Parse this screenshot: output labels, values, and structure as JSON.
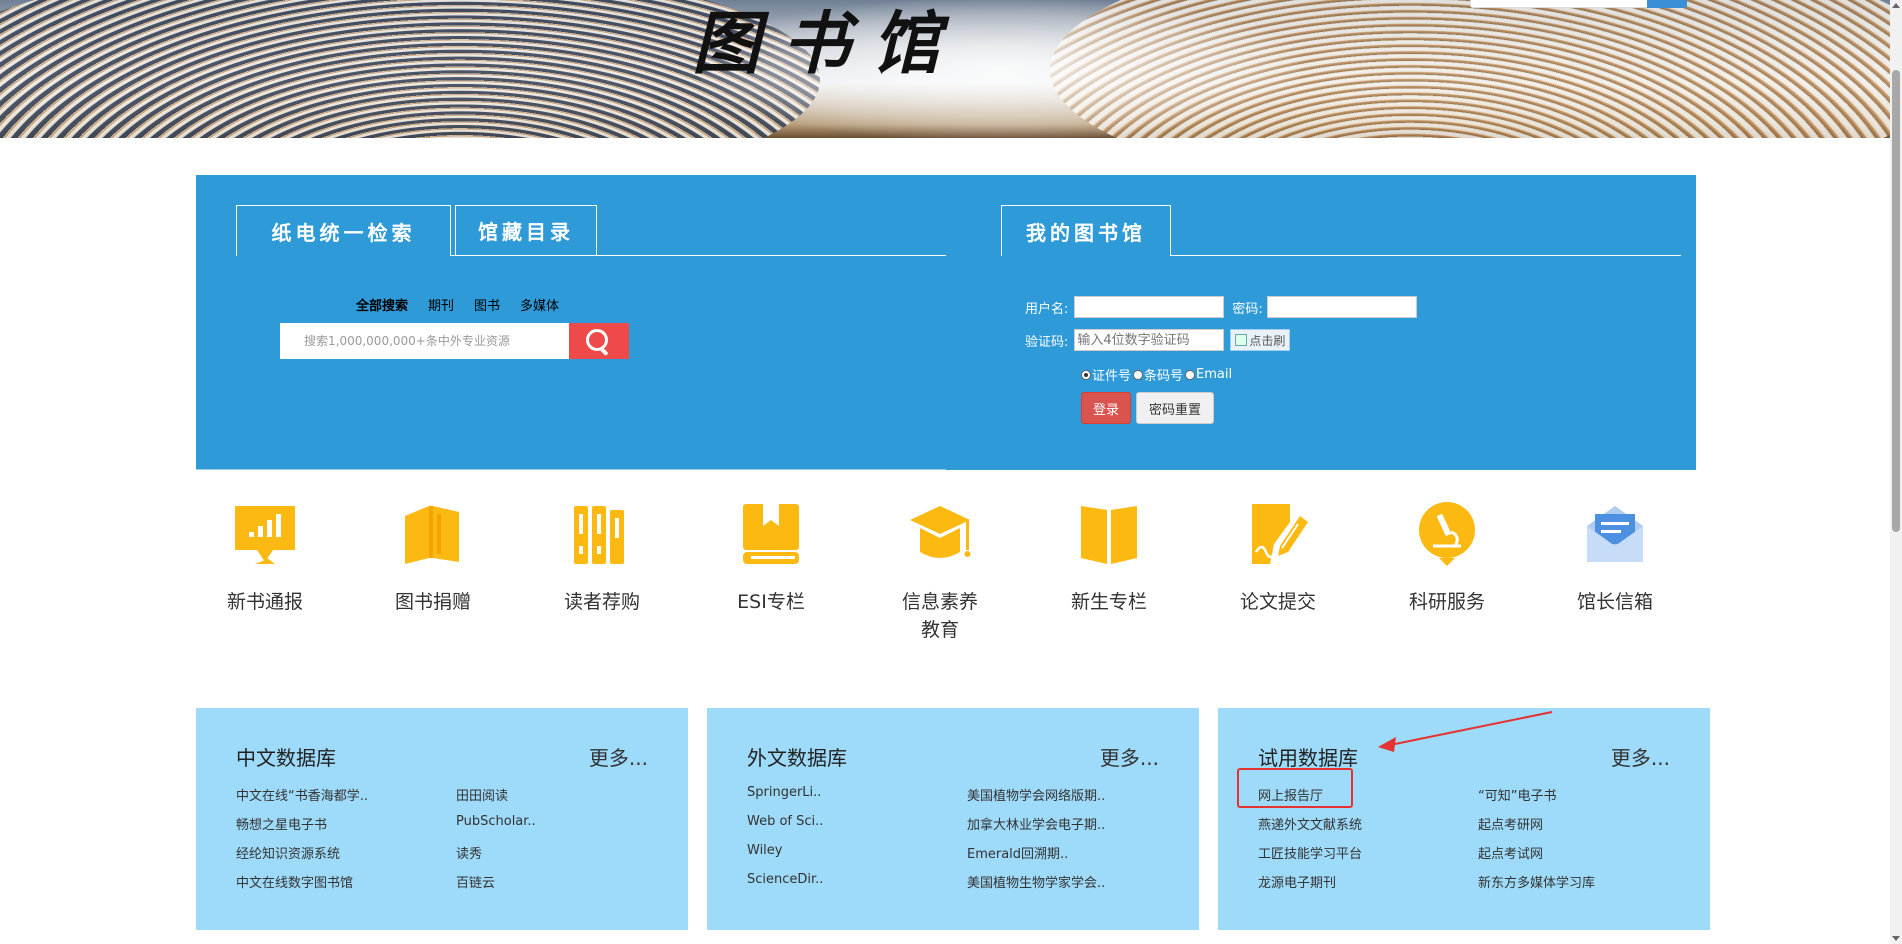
{
  "banner": {
    "title": "图书馆"
  },
  "search_tabs": [
    "纸电统一检索",
    "馆藏目录"
  ],
  "search": {
    "filters": [
      "全部搜索",
      "期刊",
      "图书",
      "多媒体"
    ],
    "placeholder": "搜索1,000,000,000+条中外专业资源"
  },
  "mylib": {
    "tab": "我的图书馆",
    "username_label": "用户名:",
    "password_label": "密码:",
    "captcha_label": "验证码:",
    "captcha_placeholder": "输入4位数字验证码",
    "captcha_image_alt": "点击刷",
    "radios": [
      "证件号",
      "条码号",
      "Email"
    ],
    "login_button": "登录",
    "reset_button": "密码重置"
  },
  "services": [
    {
      "label": "新书通报",
      "icon": "new-books-icon"
    },
    {
      "label": "图书捐赠",
      "icon": "book-donation-icon"
    },
    {
      "label": "读者荐购",
      "icon": "reader-recommend-icon"
    },
    {
      "label": "ESI专栏",
      "icon": "esi-book-icon"
    },
    {
      "label": "信息素养\n教育",
      "icon": "graduation-cap-icon"
    },
    {
      "label": "新生专栏",
      "icon": "open-book-icon"
    },
    {
      "label": "论文提交",
      "icon": "paper-submit-icon"
    },
    {
      "label": "科研服务",
      "icon": "microscope-icon"
    },
    {
      "label": "馆长信箱",
      "icon": "mailbox-icon"
    }
  ],
  "databases": [
    {
      "title": "中文数据库",
      "more": "更多...",
      "col1": [
        "中文在线“书香海都学..",
        "畅想之星电子书",
        "经纶知识资源系统",
        "中文在线数字图书馆"
      ],
      "col2": [
        "田田阅读",
        "PubScholar..",
        "读秀",
        "百链云"
      ]
    },
    {
      "title": "外文数据库",
      "more": "更多...",
      "col1": [
        "SpringerLi..",
        "Web of Sci..",
        "Wiley",
        "ScienceDir.."
      ],
      "col2": [
        "美国植物学会网络版期..",
        "加拿大林业学会电子期..",
        "Emerald回溯期..",
        "美国植物生物学家学会.."
      ]
    },
    {
      "title": "试用数据库",
      "more": "更多...",
      "col1": [
        "网上报告厅",
        "燕递外文文献系统",
        "工匠技能学习平台",
        "龙源电子期刊"
      ],
      "col2": [
        "“可知”电子书",
        "起点考研网",
        "起点考试网",
        "新东方多媒体学习库"
      ]
    }
  ],
  "colors": {
    "panel_blue": "#2e9ad8",
    "db_blue": "#9edaf9",
    "icon_yellow": "#fbb912",
    "search_red": "#ef4a4a",
    "login_red": "#d9534f",
    "annotation_red": "#e53232"
  }
}
